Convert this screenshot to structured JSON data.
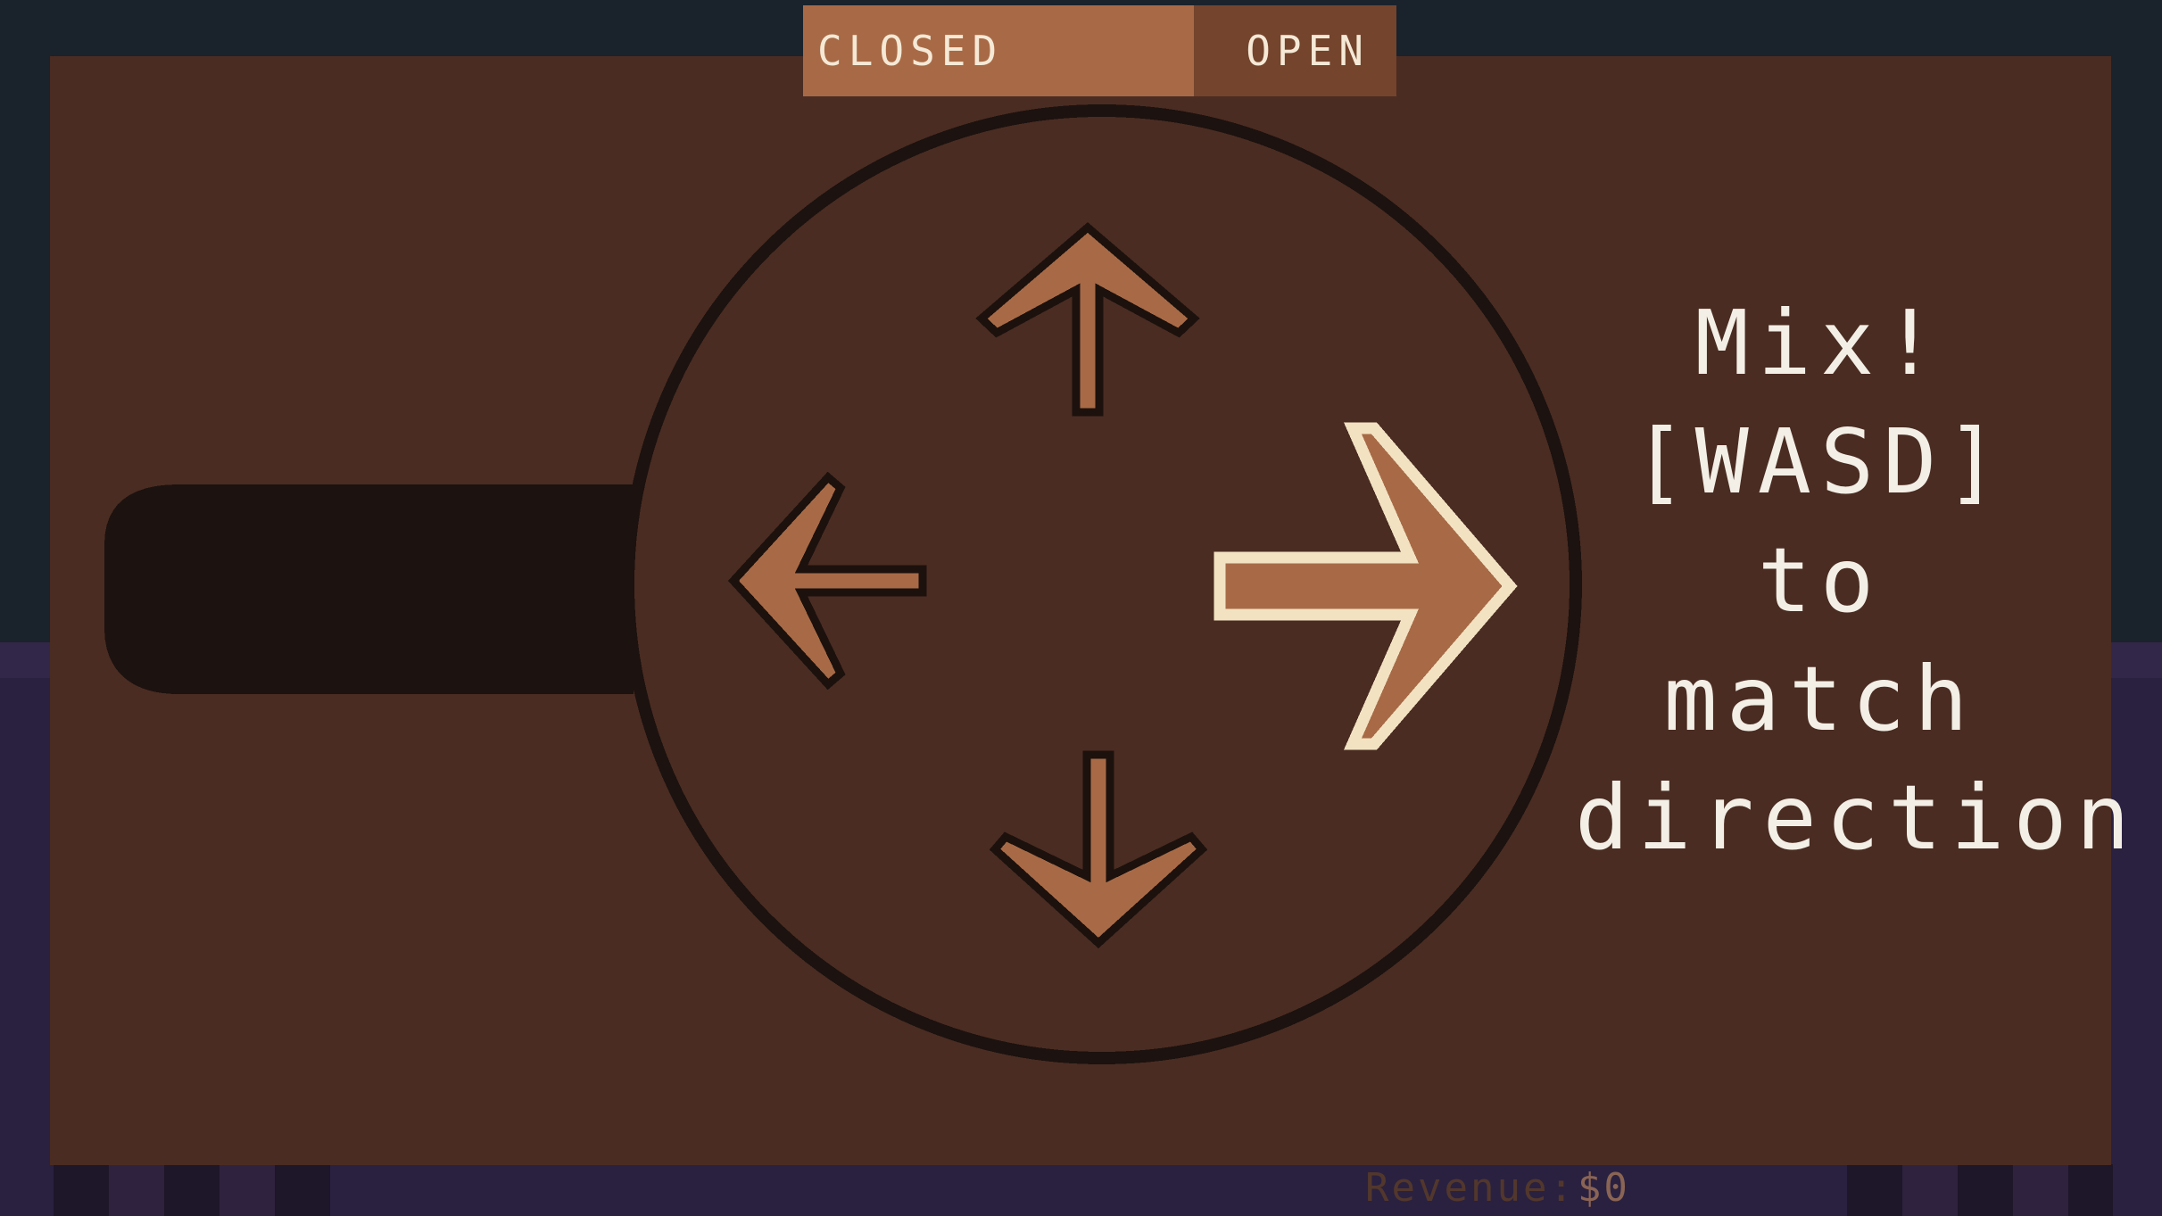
{
  "status_toggle": {
    "closed_label": "CLOSED",
    "open_label": "OPEN",
    "active": "closed"
  },
  "instructions": {
    "lines": [
      "Mix!",
      "[WASD]",
      "to",
      "match",
      "direction"
    ]
  },
  "hud": {
    "revenue_label": "Revenue:",
    "revenue_value": "$0"
  },
  "arrows": [
    {
      "direction": "up",
      "highlighted": false
    },
    {
      "direction": "left",
      "highlighted": false
    },
    {
      "direction": "right",
      "highlighted": true
    },
    {
      "direction": "down",
      "highlighted": false
    }
  ],
  "colors": {
    "background_dark": "#1a222c",
    "table_purple": "#2a2140",
    "panel_brown": "#4a2c22",
    "pan_shadow": "#1c120f",
    "arrow_fill": "#a86a46",
    "arrow_outline": "#1c110d",
    "arrow_highlight_outline": "#f2e2c2",
    "toggle_active": "#a86a46",
    "toggle_inactive": "#74442d",
    "toggle_text": "#f5e9d6",
    "text_light": "#f3efe6"
  }
}
